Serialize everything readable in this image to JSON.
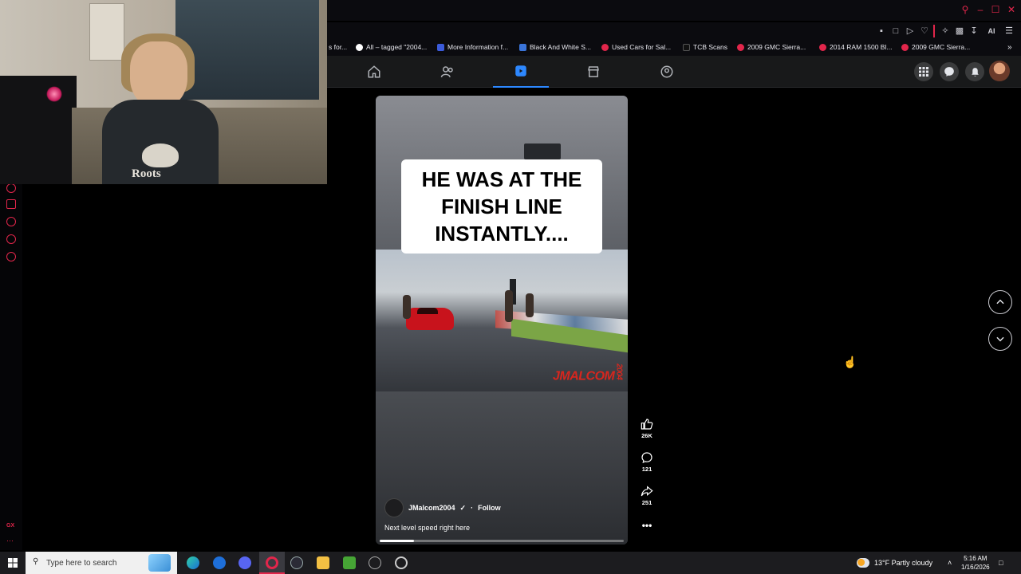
{
  "browser": {
    "accent": "#e2264b",
    "toolbar_ai_label": "AI",
    "bookmarks": [
      {
        "label": "s for...",
        "color": "#8a8a8a"
      },
      {
        "label": "All – tagged \"2004...",
        "color": "#ffffff"
      },
      {
        "label": "More Information f...",
        "color": "#3b5bdb"
      },
      {
        "label": "Black And White S...",
        "color": "#3a74d9"
      },
      {
        "label": "Used Cars for Sal...",
        "color": "#e2264b"
      },
      {
        "label": "TCB Scans",
        "color": "#111111"
      },
      {
        "label": "2009 GMC Sierra...",
        "color": "#e2264b"
      },
      {
        "label": "2014 RAM 1500 Bl...",
        "color": "#e2264b"
      },
      {
        "label": "2009 GMC Sierra...",
        "color": "#e2264b"
      }
    ]
  },
  "facebook": {
    "nav_accent": "#2d88ff",
    "tabs": [
      "home-icon",
      "friends-icon",
      "reels-icon",
      "marketplace-icon",
      "groups-icon"
    ],
    "active_tab": "reels"
  },
  "reel": {
    "caption_overlay": "HE WAS AT THE FINISH LINE INSTANTLY....",
    "watermark": "JMALCOM",
    "watermark_suffix": "2004",
    "owner": "JMalcom2004",
    "follow_label": "Follow",
    "caption": "Next level speed right here",
    "progress": 0.14,
    "likes": "26K",
    "comments": "121",
    "shares": "251"
  },
  "webcam": {
    "hoodie_text": "Roots"
  },
  "taskbar": {
    "search_placeholder": "Type here to search",
    "weather": "13°F  Partly cloudy",
    "time": "5:16 AM",
    "date": "1/16/2026"
  }
}
